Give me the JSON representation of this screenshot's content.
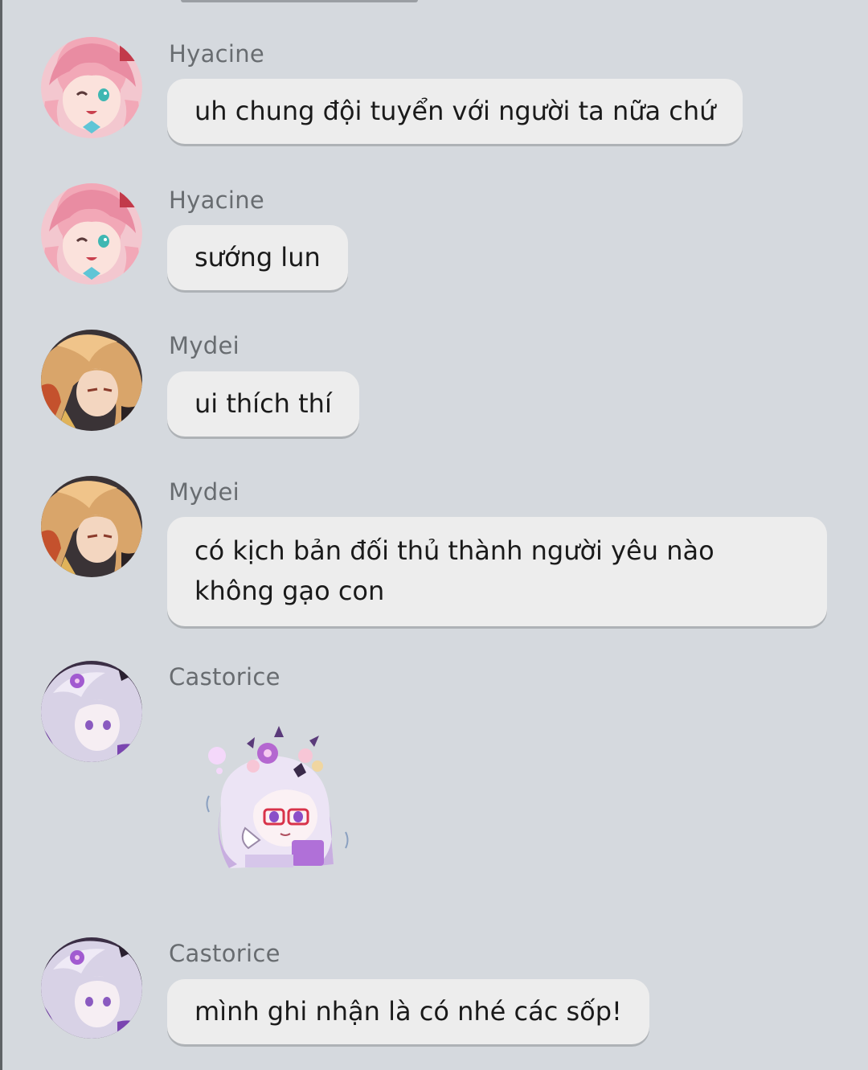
{
  "messages": [
    {
      "sender": "Hyacine",
      "text": "uh chung đội tuyển với người ta nữa chứ",
      "avatar_icon": "hyacine-avatar"
    },
    {
      "sender": "Hyacine",
      "text": "sướng lun",
      "avatar_icon": "hyacine-avatar"
    },
    {
      "sender": "Mydei",
      "text": "ui thích thí",
      "avatar_icon": "mydei-avatar"
    },
    {
      "sender": "Mydei",
      "text": "có kịch bản đối thủ thành người yêu nào không gạo con",
      "avatar_icon": "mydei-avatar"
    },
    {
      "sender": "Castorice",
      "sticker_icon": "castorice-chibi-sticker",
      "avatar_icon": "castorice-avatar"
    },
    {
      "sender": "Castorice",
      "text": "mình ghi nhận là có nhé các sốp!",
      "avatar_icon": "castorice-avatar"
    }
  ],
  "colors": {
    "background": "#d5d9de",
    "bubble": "#ededed",
    "sender_name": "#686c70",
    "message_text": "#1a1a1a"
  }
}
